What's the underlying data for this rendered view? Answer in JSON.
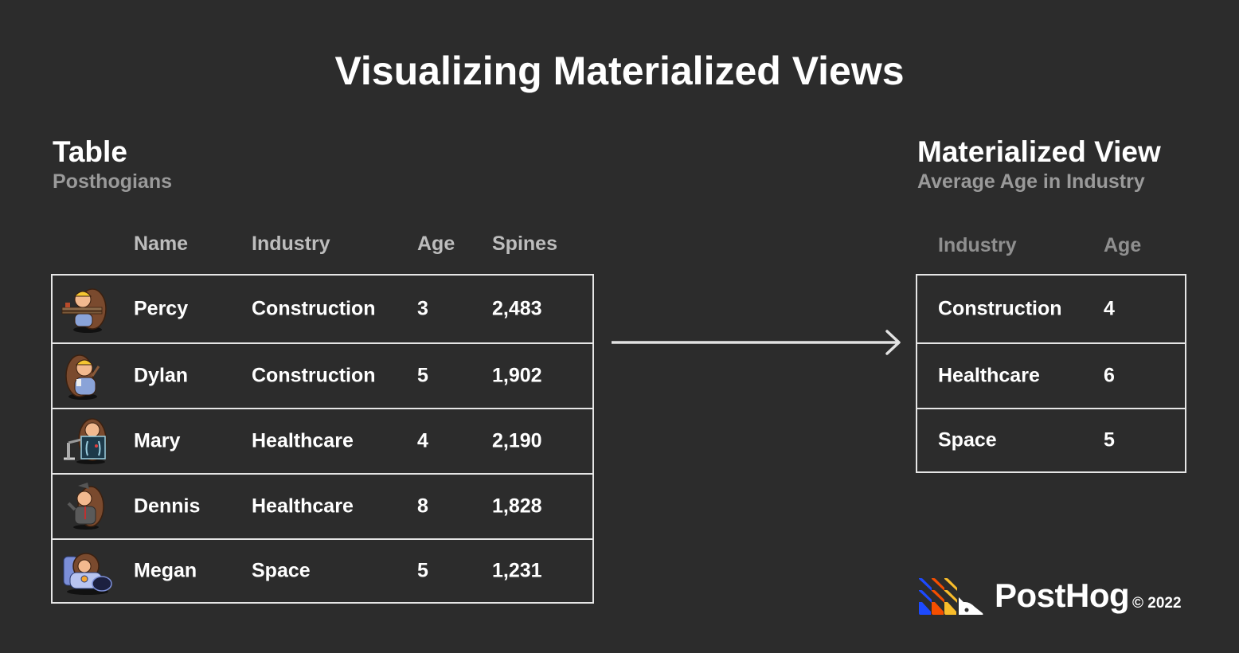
{
  "title": "Visualizing Materialized Views",
  "source_table": {
    "title": "Table",
    "subtitle": "Posthogians",
    "columns": [
      "Name",
      "Industry",
      "Age",
      "Spines"
    ],
    "rows": [
      {
        "avatar": "hedgehog-construction-carrying-planks",
        "name": "Percy",
        "industry": "Construction",
        "age": "3",
        "spines": "2,483"
      },
      {
        "avatar": "hedgehog-construction-with-clipboard",
        "name": "Dylan",
        "industry": "Construction",
        "age": "5",
        "spines": "1,902"
      },
      {
        "avatar": "hedgehog-xray-technician",
        "name": "Mary",
        "industry": "Healthcare",
        "age": "4",
        "spines": "2,190"
      },
      {
        "avatar": "hedgehog-doctor-graduate",
        "name": "Dennis",
        "industry": "Healthcare",
        "age": "8",
        "spines": "1,828"
      },
      {
        "avatar": "hedgehog-astronaut",
        "name": "Megan",
        "industry": "Space",
        "age": "5",
        "spines": "1,231"
      }
    ]
  },
  "arrow": "arrow-right-icon",
  "materialized_view": {
    "title": "Materialized View",
    "subtitle": "Average Age in Industry",
    "columns": [
      "Industry",
      "Age"
    ],
    "rows": [
      {
        "industry": "Construction",
        "age": "4"
      },
      {
        "industry": "Healthcare",
        "age": "6"
      },
      {
        "industry": "Space",
        "age": "5"
      }
    ]
  },
  "footer": {
    "brand": "PostHog",
    "copyright": "© 2022",
    "logo_colors": [
      "#1d4aff",
      "#f54e00",
      "#f9bd2b",
      "#ffffff"
    ]
  },
  "colors": {
    "background": "#2c2c2c",
    "text": "#ffffff",
    "subtitle": "#9a9a9a",
    "border": "#e6e6e6"
  }
}
